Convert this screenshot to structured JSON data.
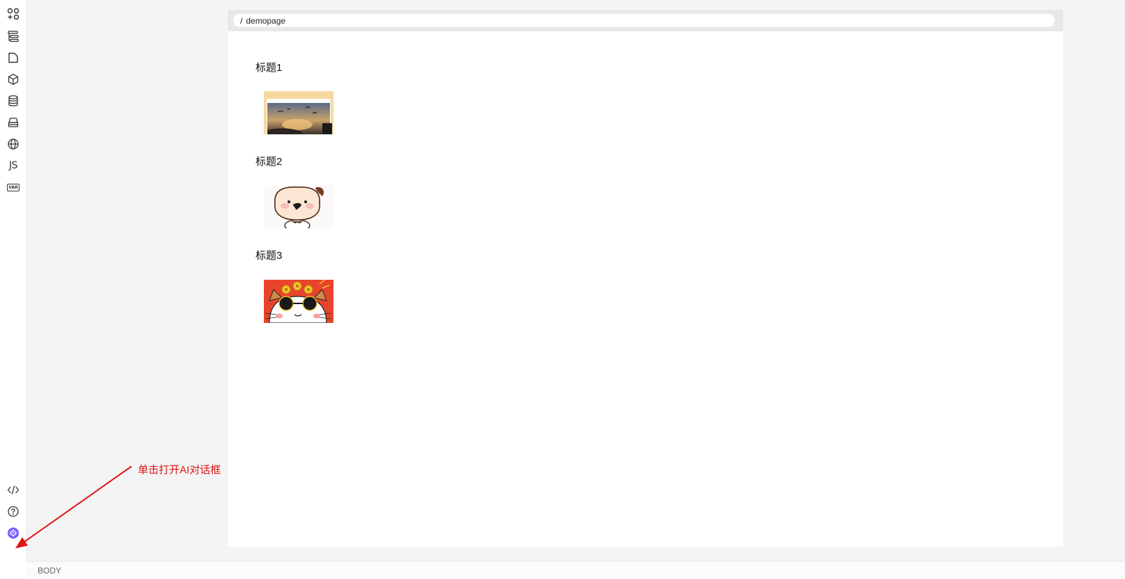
{
  "sidebar": {
    "top_items": [
      {
        "name": "components",
        "icon": "components-icon"
      },
      {
        "name": "outline",
        "icon": "outline-tree-icon"
      },
      {
        "name": "pages",
        "icon": "page-icon"
      },
      {
        "name": "blocks",
        "icon": "cube-icon"
      },
      {
        "name": "datasource",
        "icon": "database-icon"
      },
      {
        "name": "bridge",
        "icon": "bridge-icon"
      },
      {
        "name": "i18n",
        "icon": "globe-icon"
      },
      {
        "name": "js",
        "icon": "js-icon",
        "label": "JS"
      },
      {
        "name": "variables",
        "icon": "var-icon",
        "label": "VAR"
      }
    ],
    "bottom_items": [
      {
        "name": "source-code",
        "icon": "code-icon"
      },
      {
        "name": "help",
        "icon": "help-icon"
      },
      {
        "name": "ai-assistant",
        "icon": "ai-icon"
      }
    ]
  },
  "canvas": {
    "url_path": "demopage",
    "url_prefix": "/",
    "sections": [
      {
        "title": "标题1",
        "image": "sunset-birds-image"
      },
      {
        "title": "标题2",
        "image": "cartoon-puppy-image"
      },
      {
        "title": "标题3",
        "image": "cat-coins-image"
      }
    ]
  },
  "statusbar": {
    "path": "BODY"
  },
  "annotation": {
    "text": "单击打开AI对话框",
    "color": "#e11414"
  },
  "colors": {
    "ai_icon": "#7b5cff",
    "accent_red": "#e11414"
  }
}
